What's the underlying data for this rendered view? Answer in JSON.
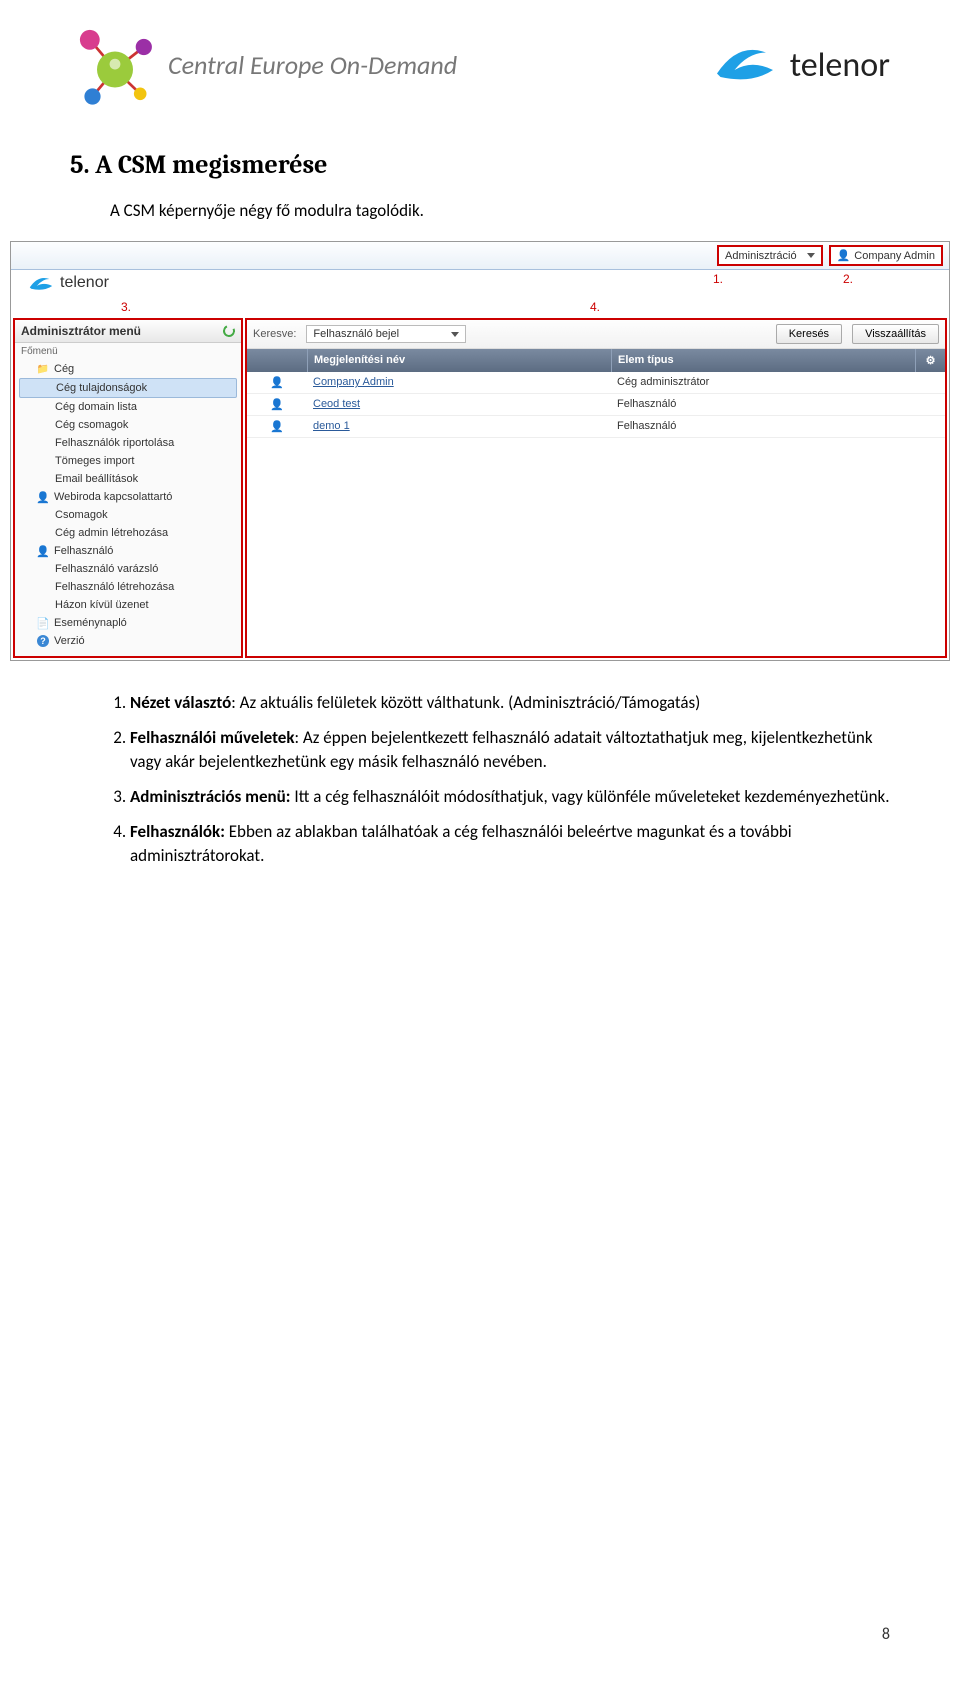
{
  "header": {
    "ceod_text": "Central Europe On-Demand",
    "telenor_text": "telenor"
  },
  "section": {
    "title": "5.  A CSM megismerése",
    "intro": "A CSM képernyője négy fő modulra tagolódik."
  },
  "screenshot": {
    "topbar": {
      "view_selector": "Adminisztráció",
      "user": "Company Admin"
    },
    "area_numbers": {
      "n1": "1.",
      "n2": "2.",
      "n3": "3.",
      "n4": "4."
    },
    "logo": "telenor",
    "sidebar": {
      "title": "Adminisztrátor menü",
      "subtitle": "Főmenü",
      "items": [
        {
          "label": "Cég",
          "icon": "folder",
          "level": 0
        },
        {
          "label": "Cég tulajdonságok",
          "level": 1,
          "selected": true
        },
        {
          "label": "Cég domain lista",
          "level": 1
        },
        {
          "label": "Cég csomagok",
          "level": 1
        },
        {
          "label": "Felhasználók riportolása",
          "level": 1
        },
        {
          "label": "Tömeges import",
          "level": 1
        },
        {
          "label": "Email beállítások",
          "level": 1
        },
        {
          "label": "Webiroda kapcsolattartó",
          "icon": "person",
          "level": 0
        },
        {
          "label": "Csomagok",
          "level": 1
        },
        {
          "label": "Cég admin létrehozása",
          "level": 1
        },
        {
          "label": "Felhasználó",
          "icon": "person",
          "level": 0
        },
        {
          "label": "Felhasználó varázsló",
          "level": 1
        },
        {
          "label": "Felhasználó létrehozása",
          "level": 1
        },
        {
          "label": "Házon kívül üzenet",
          "level": 1
        },
        {
          "label": "Eseménynapló",
          "icon": "log",
          "level": 0
        },
        {
          "label": "Verzió",
          "icon": "help",
          "level": 0
        }
      ]
    },
    "search": {
      "label": "Keresve:",
      "field": "Felhasználó bejel",
      "btn_search": "Keresés",
      "btn_reset": "Visszaállítás"
    },
    "table": {
      "head_name": "Megjelenítési név",
      "head_type": "Elem típus",
      "rows": [
        {
          "name": "Company Admin",
          "type": "Cég adminisztrátor"
        },
        {
          "name": "Ceod test",
          "type": "Felhasználó"
        },
        {
          "name": "demo 1",
          "type": "Felhasználó"
        }
      ]
    }
  },
  "list": {
    "n1": "1.",
    "b1": "Nézet választó",
    "t1": ": Az aktuális felületek között válthatunk. (Adminisztráció/Támogatás)",
    "n2": "2.",
    "b2": "Felhasználói műveletek",
    "t2": ": Az éppen bejelentkezett felhasználó adatait változtathatjuk meg, kijelentkezhetünk vagy akár bejelentkezhetünk egy másik felhasználó nevében.",
    "n3": "3.",
    "b3": "Adminisztrációs menü:",
    "t3": " Itt a cég felhasználóit módosíthatjuk, vagy különféle műveleteket kezdeményezhetünk.",
    "n4": "4.",
    "b4": "Felhasználók:",
    "t4": " Ebben az ablakban találhatóak a cég felhasználói beleértve magunkat és a további adminisztrátorokat."
  },
  "page_number": "8"
}
